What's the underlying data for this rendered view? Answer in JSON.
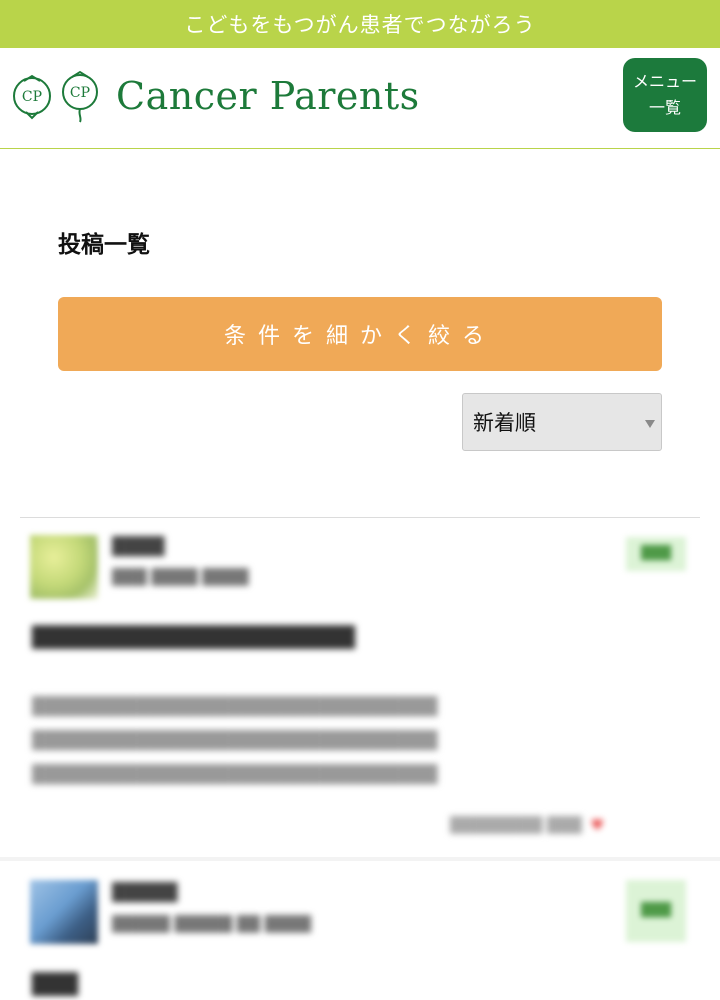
{
  "banner": {
    "tagline": "こどもをもつがん患者でつながろう"
  },
  "header": {
    "logo_text": "Cancer Parents",
    "logo_mark": "CP",
    "menu_line1": "メニュー",
    "menu_line2": "一覧"
  },
  "main": {
    "title": "投稿一覧",
    "filter_label": "条件を細かく絞る",
    "sort": {
      "selected": "新着順"
    }
  },
  "posts": [
    {
      "username": "████",
      "meta": "███ ████ ████",
      "badge": "███",
      "headline": "█████████████████████",
      "body1": "███████████████████████████████",
      "body2": "███████████████████████████████",
      "body3": "███████████████████████████████",
      "footer": "████████ ███"
    },
    {
      "username": "█████",
      "meta": "█████ █████ ██ ████",
      "badge": "███",
      "headline": "███"
    }
  ],
  "colors": {
    "banner": "#b9d44a",
    "brand_green": "#1d7a3a",
    "filter_button": "#f0a957",
    "badge_bg": "#dcf3d6"
  }
}
